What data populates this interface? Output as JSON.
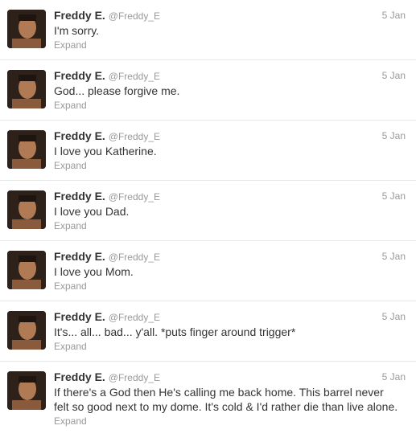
{
  "tweets": [
    {
      "name": "Freddy E.",
      "handle": "@Freddy_E",
      "time": "5 Jan",
      "text": "I'm sorry.",
      "expand": "Expand"
    },
    {
      "name": "Freddy E.",
      "handle": "@Freddy_E",
      "time": "5 Jan",
      "text": "God... please forgive me.",
      "expand": "Expand"
    },
    {
      "name": "Freddy E.",
      "handle": "@Freddy_E",
      "time": "5 Jan",
      "text": "I love you Katherine.",
      "expand": "Expand"
    },
    {
      "name": "Freddy E.",
      "handle": "@Freddy_E",
      "time": "5 Jan",
      "text": "I love you Dad.",
      "expand": "Expand"
    },
    {
      "name": "Freddy E.",
      "handle": "@Freddy_E",
      "time": "5 Jan",
      "text": "I love you Mom.",
      "expand": "Expand"
    },
    {
      "name": "Freddy E.",
      "handle": "@Freddy_E",
      "time": "5 Jan",
      "text": "It's... all... bad... y'all. *puts finger around trigger*",
      "expand": "Expand"
    },
    {
      "name": "Freddy E.",
      "handle": "@Freddy_E",
      "time": "5 Jan",
      "text": "If there's a God then He's calling me back home. This barrel never felt so good next to my dome. It's cold & I'd rather die than live alone.",
      "expand": "Expand"
    }
  ]
}
